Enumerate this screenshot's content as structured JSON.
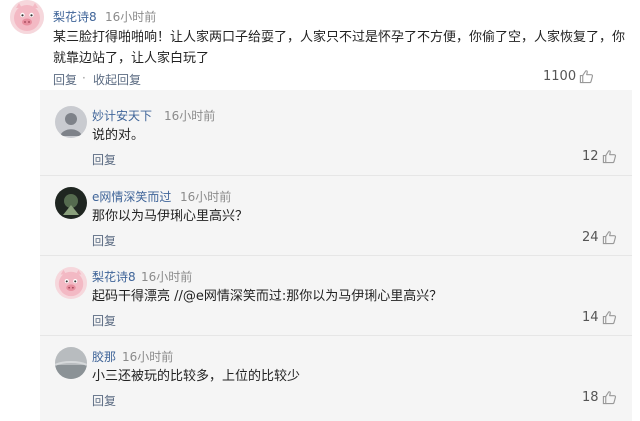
{
  "top_comment": {
    "username": "梨花诗8",
    "time": "16小时前",
    "text_line1": "某三脸打得啪啪响！让人家两口子给耍了，人家只不过是怀孕了不方便，你偷了空，人家恢复了，你",
    "text_line2": "就靠边站了，让人家白玩了",
    "reply_label": "回复",
    "separator": "·",
    "collapse_label": "收起回复",
    "like_count": "1100"
  },
  "replies": [
    {
      "username": "妙计安天下",
      "time": "16小时前",
      "text": "说的对。",
      "reply_label": "回复",
      "like_count": "12"
    },
    {
      "username": "e网情深笑而过",
      "time": "16小时前",
      "text": "那你以为马伊琍心里高兴？",
      "reply_label": "回复",
      "like_count": "24"
    },
    {
      "username": "梨花诗8",
      "time": "16小时前",
      "text": "起码干得漂亮 //@e网情深笑而过:那你以为马伊琍心里高兴？",
      "reply_label": "回复",
      "like_count": "14"
    },
    {
      "username": "胶那",
      "time": "16小时前",
      "text": "小三还被玩的比较多，上位的比较少",
      "reply_label": "回复",
      "like_count": "18"
    }
  ],
  "colors": {
    "username": "#406599",
    "time": "#8b8b8b",
    "panel_bg": "#f5f5f5"
  },
  "icons": {
    "like": "thumbs-up-icon"
  }
}
